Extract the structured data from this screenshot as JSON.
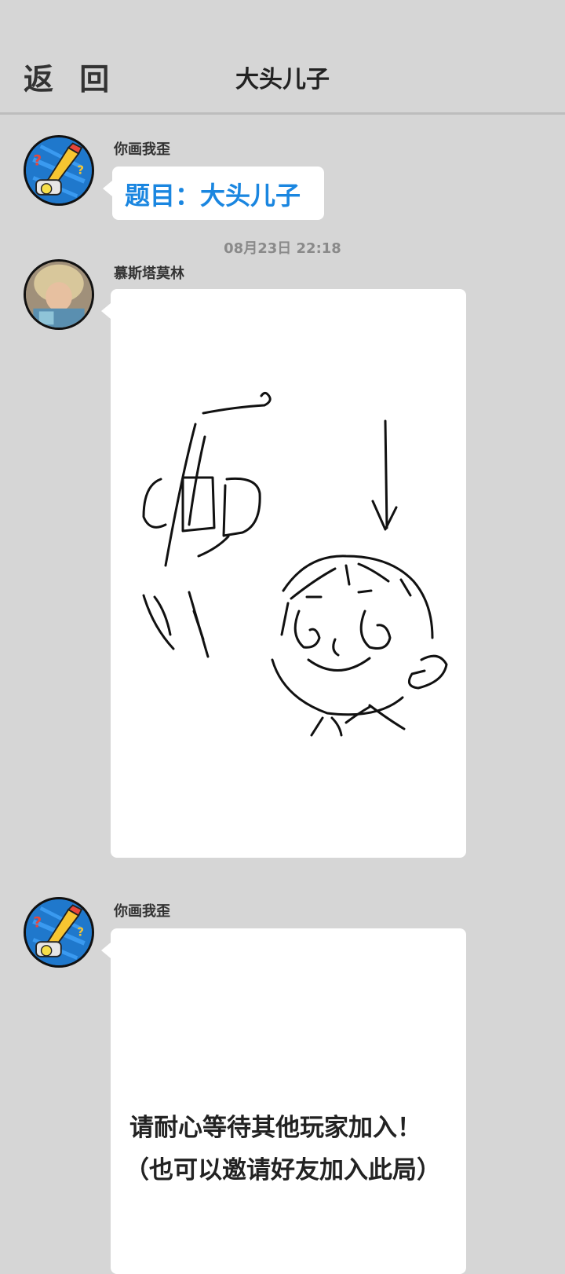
{
  "header": {
    "back_label": "返 回",
    "title": "大头儿子"
  },
  "messages": [
    {
      "sender": "你画我歪",
      "text": "题目：大头儿子"
    },
    {
      "timestamp": "08月23日  22:18",
      "sender": "慕斯塔莫林"
    },
    {
      "sender": "你画我歪",
      "line1": "请耐心等待其他玩家加入！",
      "line2": "（也可以邀请好友加入此局）"
    }
  ]
}
